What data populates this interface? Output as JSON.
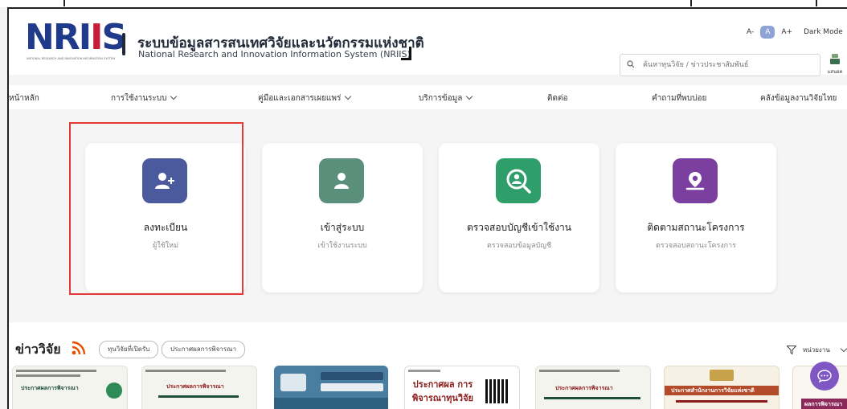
{
  "header": {
    "logo": "NRIIS",
    "logo_sub": "NATIONAL RESEARCH AND INNOVATION INFORMATION SYSTEM",
    "title_th": "ระบบข้อมูลสารสนเทศวิจัยและนวัตกรรมแห่งชาติ",
    "title_en": "National Research and Innovation Information System (NRIIS)",
    "font_smaller": "A-",
    "font_default": "A",
    "font_larger": "A+",
    "dark_mode": "Dark Mode",
    "search_placeholder": "ค้นหาทุนวิจัย / ข่าวประชาสัมพันธ์",
    "login_label": "แสนอต"
  },
  "nav": {
    "items": [
      {
        "label": "หน้าหลัก"
      },
      {
        "label": "การใช้งานระบบ"
      },
      {
        "label": "คู่มือและเอกสารเผยแพร่"
      },
      {
        "label": "บริการข้อมูล"
      },
      {
        "label": "ติดต่อ"
      },
      {
        "label": "คำถามที่พบบ่อย"
      },
      {
        "label": "คลังข้อมูลงานวิจัยไทย"
      }
    ]
  },
  "cards": [
    {
      "title": "ลงทะเบียน",
      "subtitle": "ผู้ใช้ใหม่",
      "icon": "user-add-icon",
      "color": "#4a5a9c"
    },
    {
      "title": "เข้าสู่ระบบ",
      "subtitle": "เข้าใช้งานระบบ",
      "icon": "user-icon",
      "color": "#5a8f7b"
    },
    {
      "title": "ตรวจสอบบัญชีเข้าใช้งาน",
      "subtitle": "ตรวจสอบข้อมูลบัญชี",
      "icon": "search-user-icon",
      "color": "#2e9e6a"
    },
    {
      "title": "ติดตามสถานะโครงการ",
      "subtitle": "ตรวจสอบสถานะโครงการ",
      "icon": "location-icon",
      "color": "#7b3fa0"
    }
  ],
  "news": {
    "title": "ข่าววิจัย",
    "tab1": "ทุนวิจัยที่เปิดรับ",
    "tab2": "ประกาศผลการพิจารณา",
    "filter": "หน่วยงาน",
    "thumb_texts": [
      "ประกาศผลการพิจารณา",
      "ประกาศผลการพิจารณา",
      "",
      "ประกาศผล การพิจารณาทุนวิจัย",
      "ประกาศผลการพิจารณา",
      "ประกาศสำนักงานการวิจัยแห่งชาติ",
      "ผลการพิจารณา"
    ]
  }
}
